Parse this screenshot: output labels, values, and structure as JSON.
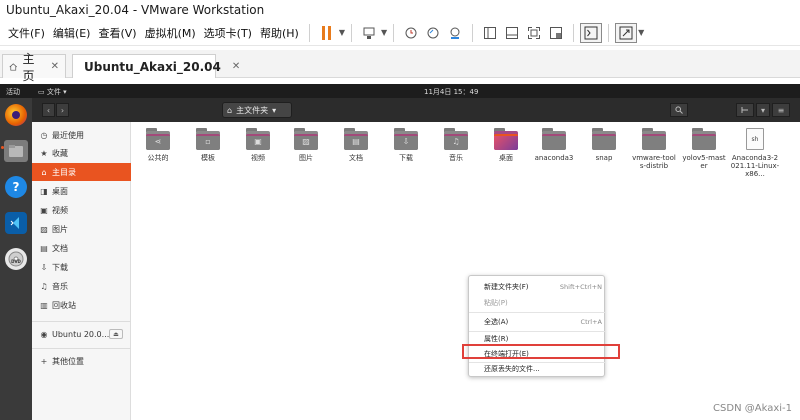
{
  "window": {
    "title": "Ubuntu_Akaxi_20.04 - VMware Workstation"
  },
  "menu": [
    "文件(F)",
    "编辑(E)",
    "查看(V)",
    "虚拟机(M)",
    "选项卡(T)",
    "帮助(H)"
  ],
  "toolbar_icons": [
    "pause-icon",
    "send-keys-icon",
    "snapshot-icon",
    "snapshot-revert-icon",
    "snapshot-manager-icon",
    "sidebar-icon",
    "thumbnail-icon",
    "fullscreen-icon",
    "unity-icon",
    "console-icon",
    "stretch-icon"
  ],
  "tabs": [
    {
      "label": "主页",
      "icon": "home-icon"
    },
    {
      "label": "Ubuntu_Akaxi_20.04",
      "icon": "vm-icon",
      "active": true
    }
  ],
  "ubuntu": {
    "activities": "活动",
    "app_menu": "文件",
    "clock": "11月4日  15：49",
    "path_label": "主文件夹"
  },
  "dock": [
    {
      "name": "firefox-icon",
      "color": "#e66000"
    },
    {
      "name": "files-icon",
      "color": "#8e8e8e"
    },
    {
      "name": "help-icon",
      "color": "#1e88e5"
    },
    {
      "name": "vscode-icon",
      "color": "#0078d4"
    },
    {
      "name": "dvd-icon",
      "color": "#eaeaea"
    }
  ],
  "sidebar": {
    "items": [
      {
        "label": "最近使用",
        "icon": "clock-icon"
      },
      {
        "label": "收藏",
        "icon": "star-icon"
      },
      {
        "label": "主目录",
        "icon": "home-icon",
        "active": true
      },
      {
        "label": "桌面",
        "icon": "desktop-icon"
      },
      {
        "label": "视频",
        "icon": "video-icon"
      },
      {
        "label": "图片",
        "icon": "picture-icon"
      },
      {
        "label": "文档",
        "icon": "document-icon"
      },
      {
        "label": "下载",
        "icon": "download-icon"
      },
      {
        "label": "音乐",
        "icon": "music-icon"
      },
      {
        "label": "回收站",
        "icon": "trash-icon"
      }
    ],
    "device": "Ubuntu 20.0...",
    "other": "其他位置"
  },
  "files": [
    {
      "name": "公共的",
      "glyph": "share"
    },
    {
      "name": "模板",
      "glyph": "template"
    },
    {
      "name": "视频",
      "glyph": "video"
    },
    {
      "name": "图片",
      "glyph": "picture"
    },
    {
      "name": "文档",
      "glyph": "document"
    },
    {
      "name": "下载",
      "glyph": "download"
    },
    {
      "name": "音乐",
      "glyph": "music"
    },
    {
      "name": "桌面",
      "glyph": "desktop"
    },
    {
      "name": "anaconda3",
      "glyph": ""
    },
    {
      "name": "snap",
      "glyph": ""
    },
    {
      "name": "vmware-tools-distrib",
      "glyph": ""
    },
    {
      "name": "yolov5-master",
      "glyph": ""
    },
    {
      "name": "Anaconda3-2021.11-Linux-x86...",
      "glyph": "file",
      "file_badge": "sh"
    }
  ],
  "context_menu": {
    "items": [
      {
        "label": "新建文件夹(F)",
        "shortcut": "Shift+Ctrl+N"
      },
      {
        "label": "粘贴(P)",
        "shortcut": "",
        "disabled": true
      },
      {
        "label": "全选(A)",
        "shortcut": "Ctrl+A"
      },
      {
        "label": "属性(R)",
        "shortcut": ""
      },
      {
        "label": "在终端打开(E)",
        "shortcut": ""
      },
      {
        "label": "还原丢失的文件...",
        "shortcut": ""
      }
    ]
  },
  "watermark": "CSDN @Akaxi-1"
}
